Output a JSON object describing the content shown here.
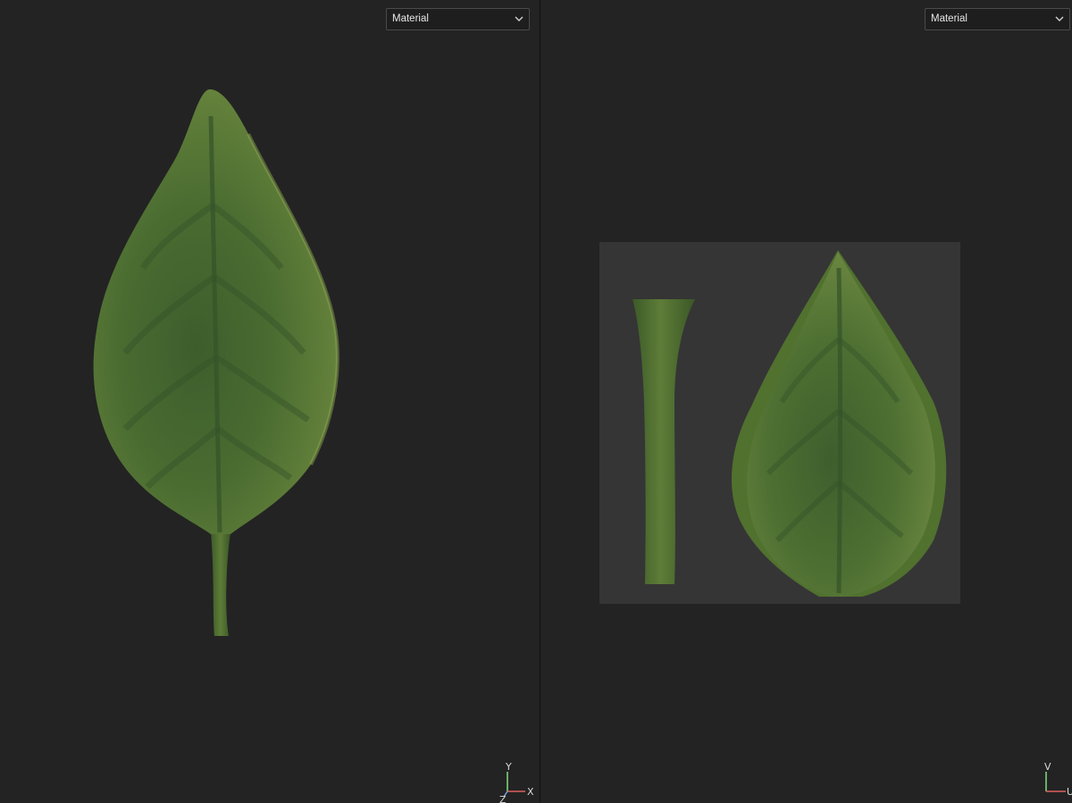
{
  "left_viewport": {
    "shading_mode": "Material",
    "axis_gizmo": {
      "y_label": "Y",
      "x_label": "X",
      "z_label": "Z"
    }
  },
  "right_viewport": {
    "shading_mode": "Material",
    "axis_gizmo": {
      "v_label": "V",
      "u_label": "U"
    }
  },
  "colors": {
    "viewport_bg": "#232323",
    "uv_canvas_bg": "#353535",
    "leaf_green": "#4f6f33",
    "leaf_dark_green": "#3b5a2c",
    "leaf_light_green": "#6f8a3c",
    "axis_x": "#e06060",
    "axis_y": "#7ee07e",
    "axis_z": "#7a9ce0"
  },
  "icons": {
    "dropdown_arrow": "chevron-down-icon"
  }
}
